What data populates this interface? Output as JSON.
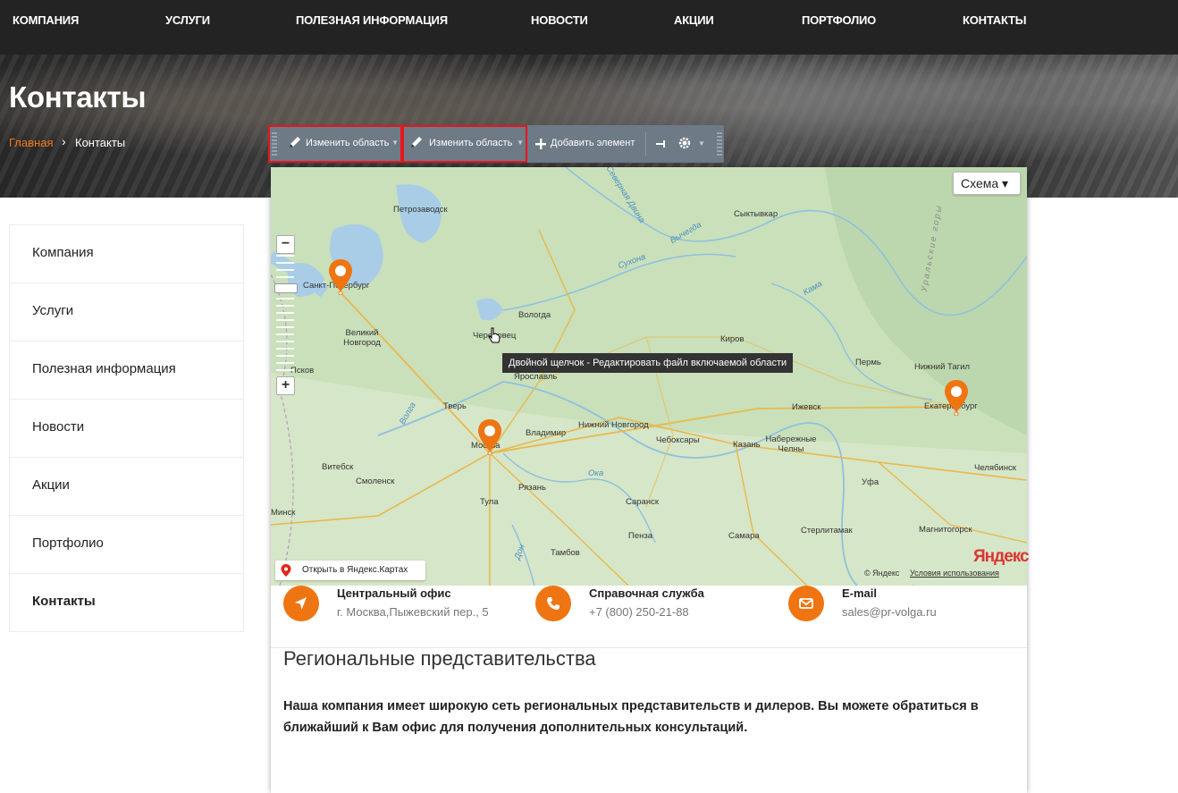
{
  "nav": {
    "items": [
      "КОМПАНИЯ",
      "УСЛУГИ",
      "ПОЛЕЗНАЯ ИНФОРМАЦИЯ",
      "НОВОСТИ",
      "АКЦИИ",
      "ПОРТФОЛИО",
      "КОНТАКТЫ"
    ]
  },
  "header": {
    "title": "Контакты",
    "breadcrumb": {
      "home": "Главная",
      "separator": "›",
      "current": "Контакты"
    }
  },
  "sidebar": {
    "items": [
      {
        "label": "Компания"
      },
      {
        "label": "Услуги"
      },
      {
        "label": "Полезная информация"
      },
      {
        "label": "Новости"
      },
      {
        "label": "Акции"
      },
      {
        "label": "Портфолио"
      },
      {
        "label": "Контакты",
        "active": true
      }
    ]
  },
  "toolbar": {
    "edit_area_1": "Изменить область",
    "edit_area_2": "Изменить область",
    "add_element": "Добавить элемент"
  },
  "map": {
    "scheme_button": "Схема ▾",
    "tooltip": "Двойной щелчок - Редактировать файл включаемой области",
    "open_in_yandex": "Открыть в Яндекс.Картах",
    "logo": "Яндекс",
    "copyright": "© Яндекс",
    "terms": "Условия использования",
    "cities": [
      "Петрозаводск",
      "Сыктывкар",
      "Санкт-Петербург",
      "Вологда",
      "Великий Новгород",
      "Череповец",
      "Киров",
      "Псков",
      "Ярославль",
      "Пермь",
      "Нижний Тагил",
      "Тверь",
      "Екатеринбург",
      "Нижний Новгород",
      "Ижевск",
      "Москва",
      "Владимир",
      "Чебоксары",
      "Казань",
      "Набережные Челны",
      "Витебск",
      "Смоленск",
      "Рязань",
      "Челябинск",
      "Уфа",
      "Тула",
      "Саранск",
      "Минск",
      "Пенза",
      "Самара",
      "Стерлитамак",
      "Магнитогорск",
      "Тамбов"
    ],
    "rivers": [
      "Северная Двина",
      "Вычегда",
      "Сухона",
      "Кама",
      "Волга",
      "Ока",
      "Дон",
      "Уральские горы"
    ],
    "accent": "#ee7511"
  },
  "contacts": [
    {
      "title": "Центральный офис",
      "value": "г. Москва,Пыжевский пер., 5",
      "icon": "location-arrow-icon"
    },
    {
      "title": "Справочная служба",
      "value": "+7 (800) 250-21-88",
      "icon": "phone-icon"
    },
    {
      "title": "E-mail",
      "value": "sales@pr-volga.ru",
      "icon": "envelope-icon"
    }
  ],
  "regional": {
    "title": "Региональные представительства",
    "text": "Наша компания имеет широкую сеть региональных представительств и дилеров. Вы можете обратиться в ближайший к Вам офис для получения дополнительных консультаций."
  }
}
